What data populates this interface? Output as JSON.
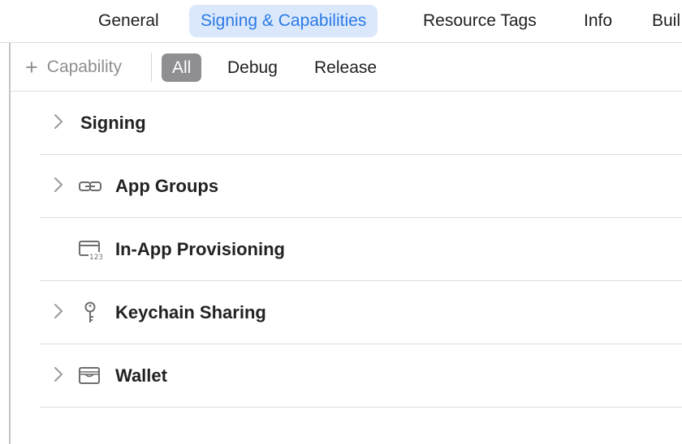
{
  "tabs": [
    {
      "label": "General",
      "active": false
    },
    {
      "label": "Signing & Capabilities",
      "active": true
    },
    {
      "label": "Resource Tags",
      "active": false
    },
    {
      "label": "Info",
      "active": false
    },
    {
      "label": "Buil",
      "active": false
    }
  ],
  "toolbar": {
    "add_capability_label": "Capability",
    "filters": [
      {
        "label": "All",
        "active": true
      },
      {
        "label": "Debug",
        "active": false
      },
      {
        "label": "Release",
        "active": false
      }
    ]
  },
  "capabilities": [
    {
      "label": "Signing",
      "icon": null,
      "expandable": true
    },
    {
      "label": "App Groups",
      "icon": "link-icon",
      "expandable": true
    },
    {
      "label": "In-App Provisioning",
      "icon": "card-123-icon",
      "expandable": false
    },
    {
      "label": "Keychain Sharing",
      "icon": "key-icon",
      "expandable": true
    },
    {
      "label": "Wallet",
      "icon": "wallet-icon",
      "expandable": true
    }
  ],
  "colors": {
    "accent": "#2b7ae6",
    "active_tab_bg": "#dbe8fb",
    "filter_active_bg": "#8e8e93"
  }
}
